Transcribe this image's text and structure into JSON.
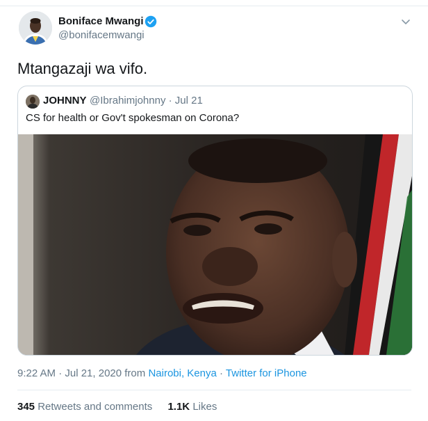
{
  "author": {
    "name": "Boniface Mwangi",
    "handle": "@bonifacemwangi",
    "verified": true,
    "avatar_icon": "user-avatar-photo"
  },
  "tweet": {
    "text": "Mtangazaji wa vifo."
  },
  "quote": {
    "name": "JOHNNY",
    "handle": "@Ibrahimjohnny",
    "separator": "·",
    "date": "Jul 21",
    "text": "CS for health or Gov't spokesman on Corona?",
    "media": "photo-of-man-speaking"
  },
  "meta": {
    "time": "9:22 AM · Jul 21, 2020 from",
    "location": "Nairobi, Kenya",
    "dot": "·",
    "source": "Twitter for iPhone"
  },
  "stats": {
    "retweets_count": "345",
    "retweets_label": "Retweets and comments",
    "likes_count": "1.1K",
    "likes_label": "Likes"
  },
  "colors": {
    "link": "#1b95e0",
    "muted": "#657786",
    "verified": "#1da1f2",
    "border": "#ccd6dd"
  }
}
